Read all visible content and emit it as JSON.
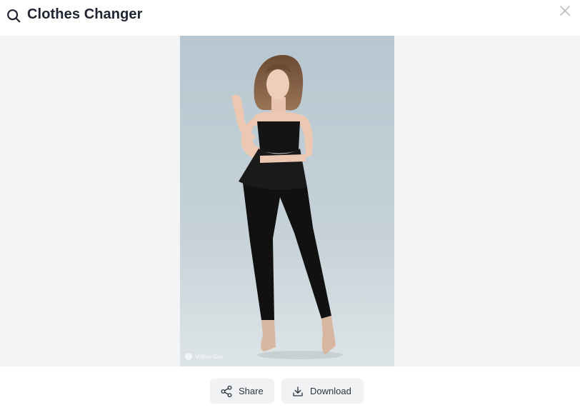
{
  "header": {
    "title": "Clothes Changer",
    "search_icon": "search-icon",
    "close_icon": "close-icon"
  },
  "image": {
    "description_icon": "photo",
    "watermark": "Vidhat Gan"
  },
  "actions": {
    "share_label": "Share",
    "download_label": "Download"
  },
  "colors": {
    "background": "#f3f4f6",
    "button_bg": "#f1f2f4",
    "text": "#1f2430"
  }
}
